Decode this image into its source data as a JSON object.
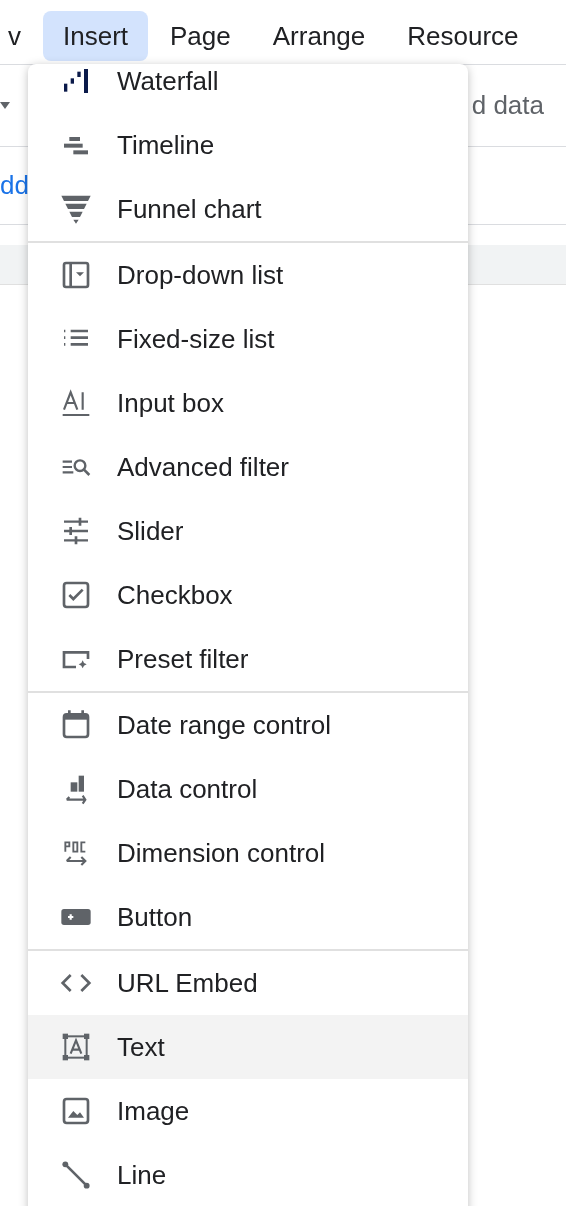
{
  "menu_bar": [
    {
      "label": "v",
      "selected": false
    },
    {
      "label": "Insert",
      "selected": true
    },
    {
      "label": "Page",
      "selected": false
    },
    {
      "label": "Arrange",
      "selected": false
    },
    {
      "label": "Resource",
      "selected": false
    }
  ],
  "background": {
    "toolbar_text": "d data",
    "link_text": "dd"
  },
  "insert_menu": {
    "sections": [
      {
        "items": [
          {
            "kind": "waterfall",
            "label": "Waterfall",
            "hovered": false
          },
          {
            "kind": "timeline",
            "label": "Timeline",
            "hovered": false
          },
          {
            "kind": "funnel",
            "label": "Funnel chart",
            "hovered": false
          }
        ]
      },
      {
        "items": [
          {
            "kind": "dropdown",
            "label": "Drop-down list",
            "hovered": false
          },
          {
            "kind": "list",
            "label": "Fixed-size list",
            "hovered": false
          },
          {
            "kind": "input",
            "label": "Input box",
            "hovered": false
          },
          {
            "kind": "advfilter",
            "label": "Advanced filter",
            "hovered": false
          },
          {
            "kind": "slider",
            "label": "Slider",
            "hovered": false
          },
          {
            "kind": "checkbox",
            "label": "Checkbox",
            "hovered": false
          },
          {
            "kind": "preset",
            "label": "Preset filter",
            "hovered": false
          }
        ]
      },
      {
        "items": [
          {
            "kind": "calendar",
            "label": "Date range control",
            "hovered": false
          },
          {
            "kind": "datactl",
            "label": "Data control",
            "hovered": false
          },
          {
            "kind": "dimctl",
            "label": "Dimension control",
            "hovered": false
          },
          {
            "kind": "button",
            "label": "Button",
            "hovered": false
          }
        ]
      },
      {
        "items": [
          {
            "kind": "code",
            "label": "URL Embed",
            "hovered": false
          },
          {
            "kind": "text",
            "label": "Text",
            "hovered": true
          },
          {
            "kind": "image",
            "label": "Image",
            "hovered": false
          },
          {
            "kind": "line",
            "label": "Line",
            "hovered": false
          }
        ]
      }
    ]
  }
}
